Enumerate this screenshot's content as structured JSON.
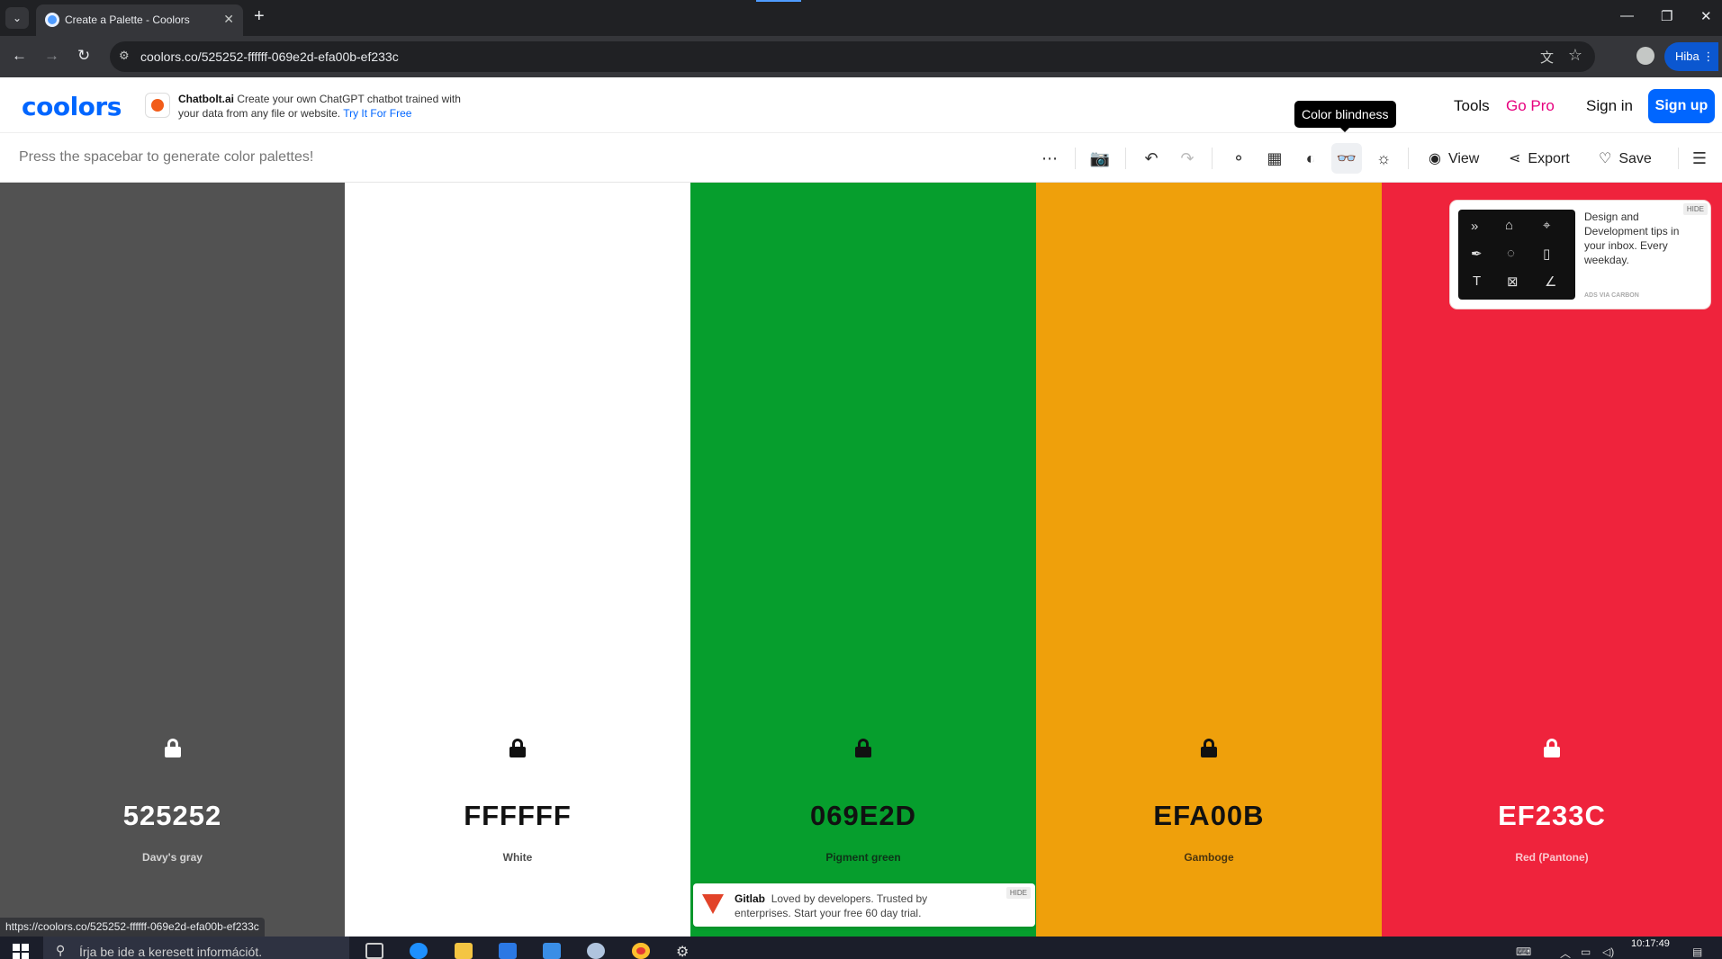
{
  "browser": {
    "tab_title": "Create a Palette - Coolors",
    "url": "coolors.co/525252-ffffff-069e2d-efa00b-ef233c",
    "profile_name": "Hiba",
    "status_url": "https://coolors.co/525252-ffffff-069e2d-efa00b-ef233c"
  },
  "header": {
    "logo": "coolors",
    "ad": {
      "brand": "Chatbolt.ai",
      "text": "Create your own ChatGPT chatbot trained with your data from any file or website.",
      "cta": "Try It For Free"
    },
    "tooltip": "Color blindness",
    "nav": {
      "tools": "Tools",
      "go_pro": "Go Pro",
      "sign_in": "Sign in",
      "sign_up": "Sign up"
    }
  },
  "toolbar": {
    "hint": "Press the spacebar to generate color palettes!",
    "view": "View",
    "export": "Export",
    "save": "Save"
  },
  "palette": [
    {
      "hex": "525252",
      "name": "Davy's gray",
      "bg": "#525252",
      "fg": "#ffffff"
    },
    {
      "hex": "FFFFFF",
      "name": "White",
      "bg": "#ffffff",
      "fg": "#111111"
    },
    {
      "hex": "069E2D",
      "name": "Pigment green",
      "bg": "#069e2d",
      "fg": "#111111"
    },
    {
      "hex": "EFA00B",
      "name": "Gamboge",
      "bg": "#efa00b",
      "fg": "#111111"
    },
    {
      "hex": "EF233C",
      "name": "Red (Pantone)",
      "bg": "#ef233c",
      "fg": "#ffffff"
    }
  ],
  "carbon_ad": {
    "text": "Design and Development tips in your inbox. Every weekday.",
    "via": "ADS VIA CARBON",
    "hide": "HIDE"
  },
  "gitlab_ad": {
    "brand": "Gitlab",
    "text": "Loved by developers. Trusted by enterprises. Start your free 60 day trial.",
    "hide": "HIDE"
  },
  "taskbar": {
    "search_placeholder": "Írja be ide a keresett információt.",
    "time": "10:17:49"
  }
}
